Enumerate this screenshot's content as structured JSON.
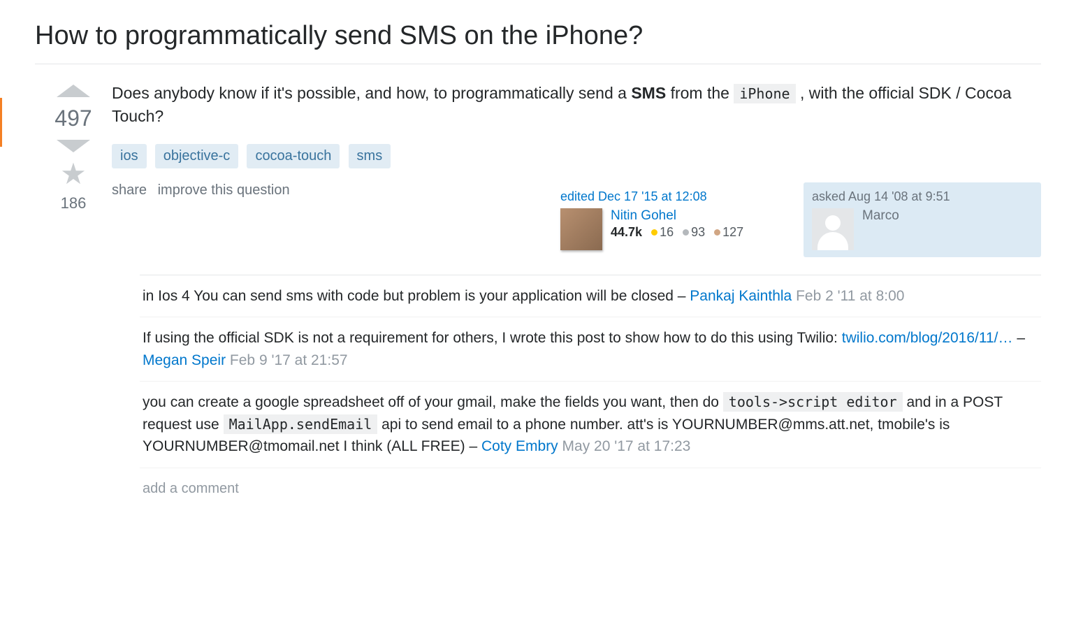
{
  "title": "How to programmatically send SMS on the iPhone?",
  "question": {
    "pre": "Does anybody know if it's possible, and how, to programmatically send a ",
    "bold": "SMS",
    "mid": " from the ",
    "code": "iPhone",
    "post": " , with the official SDK / Cocoa Touch?"
  },
  "vote": {
    "score": "497",
    "favorites": "186"
  },
  "tags": [
    "ios",
    "objective-c",
    "cocoa-touch",
    "sms"
  ],
  "actions": {
    "share": "share",
    "improve": "improve this question"
  },
  "editor": {
    "action": "edited Dec 17 '15 at 12:08",
    "name": "Nitin Gohel",
    "rep": "44.7k",
    "gold": "16",
    "silver": "93",
    "bronze": "127"
  },
  "asker": {
    "action": "asked Aug 14 '08 at 9:51",
    "name": "Marco"
  },
  "comments": [
    {
      "text": "in Ios 4 You can send sms with code but problem is your application will be closed – ",
      "author": "Pankaj Kainthla",
      "time": "Feb 2 '11 at 8:00"
    },
    {
      "text": "If using the official SDK is not a requirement for others, I wrote this post to show how to do this using Twilio: ",
      "link": "twilio.com/blog/2016/11/…",
      "sep": " – ",
      "author": "Megan Speir",
      "time": "Feb 9 '17 at 21:57"
    },
    {
      "pre": "you can create a google spreadsheet off of your gmail, make the fields you want, then do ",
      "code1": "tools->script editor",
      "mid": " and in a POST request use ",
      "code2": "MailApp.sendEmail",
      "post": " api to send email to a phone number. att's is YOURNUMBER@mms.att.net, tmobile's is YOURNUMBER@tmomail.net I think (ALL FREE) – ",
      "author": "Coty Embry",
      "time": "May 20 '17 at 17:23"
    }
  ],
  "addComment": "add a comment"
}
